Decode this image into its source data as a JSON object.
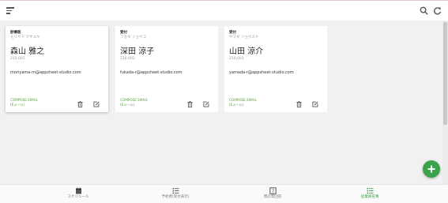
{
  "colors": {
    "accent": "#3aa24a",
    "link": "#5a9e3d",
    "topbar_border": "#e4c8c8"
  },
  "topbar": {
    "menu_icon": "menu-icon",
    "search_icon": "search-icon",
    "refresh_icon": "refresh-icon"
  },
  "cards": [
    {
      "role": "診療医",
      "kana": "モリヤマ マサユキ",
      "name": "森山 雅之",
      "code": "210,001",
      "email": "moriyama-m@appsheet-studio.com",
      "compose_line1": "COMPOSE EMAIL",
      "compose_line2": "(Eメール)"
    },
    {
      "role": "受付",
      "kana": "フカダ リョウコ",
      "name": "深田 涼子",
      "code": "210,002",
      "email": "fukada-r@appsheet-studio.com",
      "compose_line1": "COMPOSE EMAIL",
      "compose_line2": "(Eメール)"
    },
    {
      "role": "受付",
      "kana": "ヤマダ リョウスケ",
      "name": "山田 涼介",
      "code": "210,003",
      "email": "yamada-r@appsheet-studio.com",
      "compose_line1": "COMPOSE EMAIL",
      "compose_line2": "(Eメール)"
    }
  ],
  "fab": {
    "icon": "plus-icon"
  },
  "bottom_nav": [
    {
      "label": "スケジュール",
      "icon": "calendar-icon"
    },
    {
      "label": "予約者(受付表示)",
      "icon": "list-icon"
    },
    {
      "label": "問診票回答",
      "icon": "help-icon"
    },
    {
      "label": "従業員名簿",
      "icon": "list-icon",
      "active": true
    }
  ]
}
